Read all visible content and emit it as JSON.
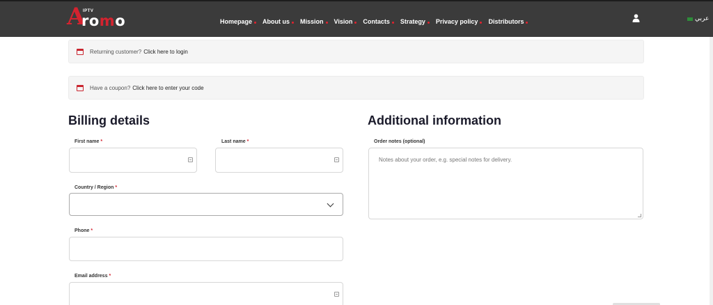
{
  "header": {
    "logo": {
      "letter": "A",
      "word_white": "ro",
      "word_red": "m",
      "word_end": "o",
      "superscript": "IPTV"
    },
    "nav": [
      {
        "label": "Homepage"
      },
      {
        "label": "About us"
      },
      {
        "label": "Mission"
      },
      {
        "label": "Vision"
      },
      {
        "label": "Contacts"
      },
      {
        "label": "Strategy"
      },
      {
        "label": "Privacy policy"
      },
      {
        "label": "Distributors"
      }
    ],
    "language": "عربي",
    "accent_color": "#e3222e"
  },
  "notices": {
    "login": {
      "text": "Returning customer?",
      "link": "Click here to login"
    },
    "coupon": {
      "text": "Have a coupon?",
      "link": "Click here to enter your code"
    }
  },
  "billing": {
    "title": "Billing details",
    "first_name": {
      "label": "First name",
      "required": "*",
      "value": ""
    },
    "last_name": {
      "label": "Last name",
      "required": "*",
      "value": ""
    },
    "country": {
      "label": "Country / Region",
      "required": "*",
      "value": ""
    },
    "phone": {
      "label": "Phone",
      "required": "*",
      "value": ""
    },
    "email": {
      "label": "Email address",
      "required": "*",
      "value": ""
    }
  },
  "additional": {
    "title": "Additional information",
    "order_notes": {
      "label": "Order notes (optional)",
      "placeholder": "Notes about your order, e.g. special notes for delivery."
    }
  }
}
